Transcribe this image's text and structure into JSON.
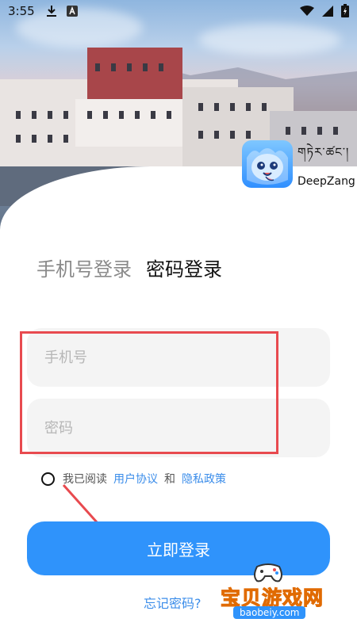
{
  "status_bar": {
    "time": "3:55",
    "left_icons": [
      "download-icon",
      "app-icon"
    ],
    "right_icons": [
      "wifi-icon",
      "signal-icon",
      "battery-charging-icon"
    ]
  },
  "logo": {
    "tibetan": "གཏེར་ཚང་།",
    "name": "DeepZang"
  },
  "tabs": [
    {
      "label": "手机号登录",
      "active": false
    },
    {
      "label": "密码登录",
      "active": true
    }
  ],
  "form": {
    "phone_placeholder": "手机号",
    "password_placeholder": "密码"
  },
  "agreement": {
    "prefix": "我已阅读",
    "user_agreement": "用户协议",
    "and": "和",
    "privacy_policy": "隐私政策",
    "checked": false
  },
  "login_button": {
    "label": "立即登录"
  },
  "forgot_password": {
    "label": "忘记密码?"
  },
  "watermark": {
    "title": "宝贝游戏网",
    "url": "baobeiy.com"
  },
  "colors": {
    "primary": "#2f93fb",
    "link": "#3b8dea",
    "highlight": "#e84a4f",
    "input_bg": "#f4f4f4"
  }
}
